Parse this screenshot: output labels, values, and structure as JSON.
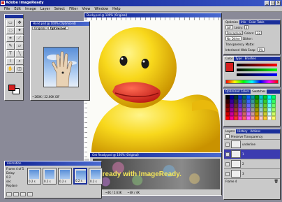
{
  "window": {
    "title": "Adobe ImageReady"
  },
  "menu": [
    "File",
    "Edit",
    "Image",
    "Layer",
    "Select",
    "Filter",
    "View",
    "Window",
    "Help"
  ],
  "doc_small": {
    "title": "Hand.psd @ 100% (Optimized)",
    "tabs": [
      "Original",
      "Optimized"
    ],
    "status": "~260K / 22.60K GIF"
  },
  "doc_big": {
    "title": "Ducky.psd @ 100% (Original)"
  },
  "doc_bottom": {
    "title": "Get Ready.psd @ 100% (Original)",
    "banner_text": "et ready with ImageReady.",
    "status": [
      "100%",
      "~4K / 2.63K",
      "~4K / 4K"
    ]
  },
  "animation": {
    "title": "Animation",
    "side": [
      "Frame 4 of 5",
      "Delay:",
      "0.2",
      "sec",
      "Replace"
    ],
    "frames": [
      "0.2 s",
      "0.2 s",
      "0.2 s",
      "0.2 s",
      "0.2 s"
    ]
  },
  "options_panel": {
    "tabs": [
      "Optimize",
      "Info",
      "Color Table"
    ],
    "rows": [
      [
        "GIF",
        "Lossy:",
        "0"
      ],
      [
        "Perceptual",
        "Colors:",
        "32"
      ],
      [
        "No Dither",
        "Dither:",
        ""
      ],
      [
        "Transparency",
        "Matte:",
        ""
      ],
      [
        "Interlaced",
        "Web Snap:",
        "0%"
      ]
    ]
  },
  "color_panel": {
    "tabs": [
      "Color",
      "Type",
      "Brushes"
    ]
  },
  "swatches_panel": {
    "tabs": [
      "Optimized Colors",
      "Swatches"
    ]
  },
  "layers_panel": {
    "tabs": [
      "Layers",
      "History",
      "Actions"
    ],
    "checkbox": "Preserve Transparency",
    "layers": [
      "underline",
      "1",
      "2",
      "3"
    ],
    "footer": "Frame 4"
  },
  "colors": {
    "accent": "#1a2f9a",
    "duck_yellow": "#f6d21a",
    "beak_red": "#e0261e",
    "foreground_swatch": "#d41e1e"
  }
}
